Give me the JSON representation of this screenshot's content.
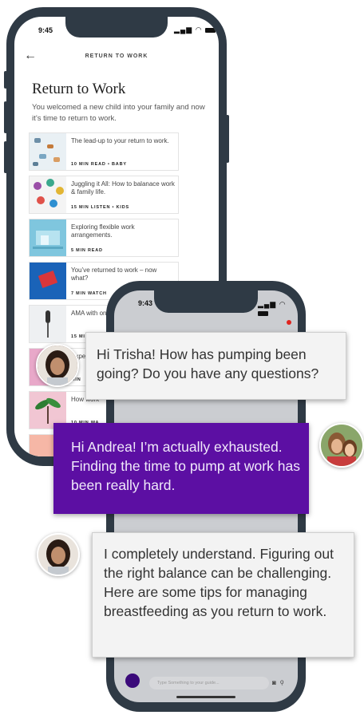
{
  "phone1": {
    "status_time": "9:45",
    "nav_title": "RETURN TO WORK",
    "page_title": "Return to Work",
    "subtitle": "You welcomed a new child into your family and now it’s time to return to work.",
    "cards": [
      {
        "title": "The lead-up to your return to work.",
        "meta": "10 MIN READ • BABY"
      },
      {
        "title": "Juggling it All: How to balanace work & family life.",
        "meta": "15 MIN LISTEN • KIDS"
      },
      {
        "title": "Exploring flexible work arrangements.",
        "meta": "5 MIN READ"
      },
      {
        "title": "You’ve returned to work – now what?",
        "meta": "7 MIN WATCH"
      },
      {
        "title": "AMA with on Return",
        "meta": "15 MIN REA"
      },
      {
        "title": "Expe tar",
        "meta": "MIN"
      },
      {
        "title": "How work",
        "meta": "10 MIN WA"
      }
    ]
  },
  "phone2": {
    "status_time": "9:43",
    "input_placeholder": "Type Something to your guide...",
    "camera_icon": "camera-icon",
    "mic_icon": "mic-icon"
  },
  "chat": {
    "guide_message_1": "Hi Trisha! How has pumping been going? Do you have any questions?",
    "user_message": "Hi Andrea! I’m actually exhausted. Finding the time to pump at work has been really hard.",
    "guide_message_2": "I completely understand. Figuring out the right balance can be challenging. Here are some tips for managing breastfeeding as you return to work."
  },
  "colors": {
    "phone_frame": "#2f3a45",
    "user_bubble": "#5c0fa3",
    "notification_dot": "#e0241f"
  }
}
